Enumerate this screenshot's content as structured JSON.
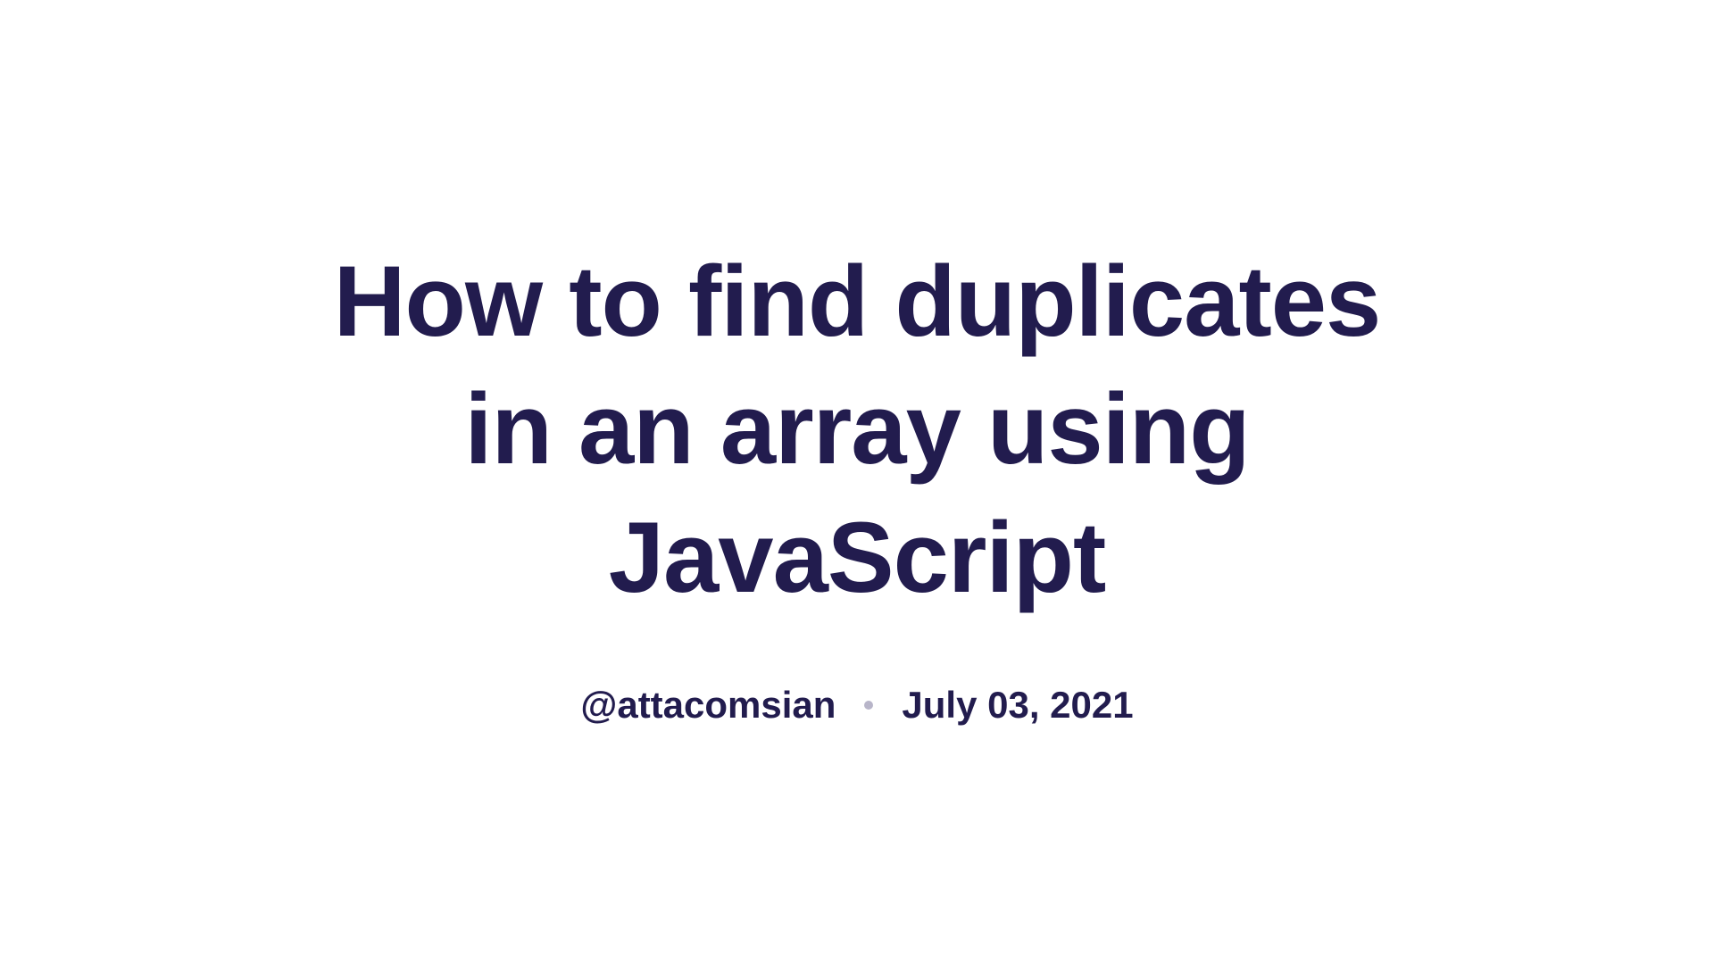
{
  "title": "How to find duplicates in an array using JavaScript",
  "author": "@attacomsian",
  "date": "July 03, 2021",
  "colors": {
    "text": "#221c4e",
    "dot": "#b8b5c9",
    "background": "#ffffff"
  }
}
